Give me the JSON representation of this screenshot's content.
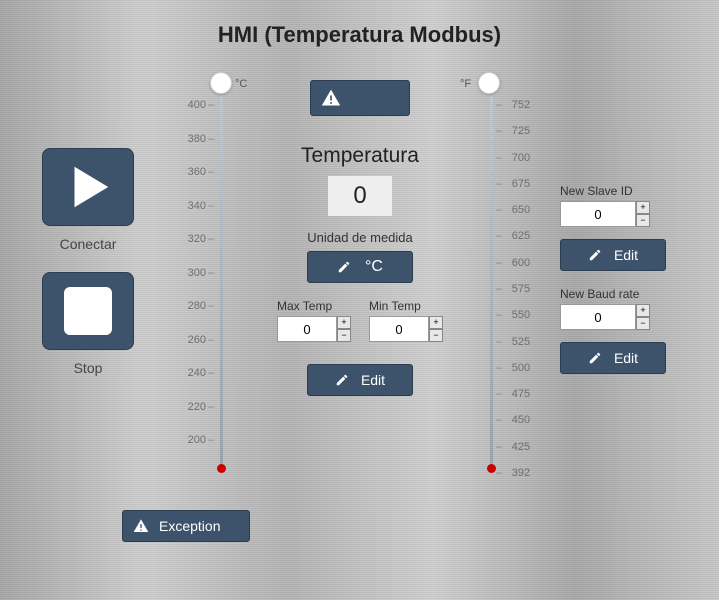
{
  "title": "HMI (Temperatura Modbus)",
  "left": {
    "connect": "Conectar",
    "stop": "Stop"
  },
  "thermo_c": {
    "unit": "°C",
    "ticks": [
      "400",
      "380",
      "360",
      "340",
      "320",
      "300",
      "280",
      "260",
      "240",
      "220",
      "200"
    ]
  },
  "thermo_f": {
    "unit": "°F",
    "ticks": [
      "752",
      "725",
      "700",
      "675",
      "650",
      "625",
      "600",
      "575",
      "550",
      "525",
      "500",
      "475",
      "450",
      "425",
      "392"
    ]
  },
  "center": {
    "temp_title": "Temperatura",
    "temp_value": "0",
    "unit_label": "Unidad de medida",
    "unit_value": "°C",
    "max_label": "Max Temp",
    "max_value": "0",
    "min_label": "Min Temp",
    "min_value": "0",
    "edit": "Edit"
  },
  "right": {
    "slave_label": "New Slave ID",
    "slave_value": "0",
    "edit1": "Edit",
    "baud_label": "New Baud rate",
    "baud_value": "0",
    "edit2": "Edit"
  },
  "exception": "Exception"
}
